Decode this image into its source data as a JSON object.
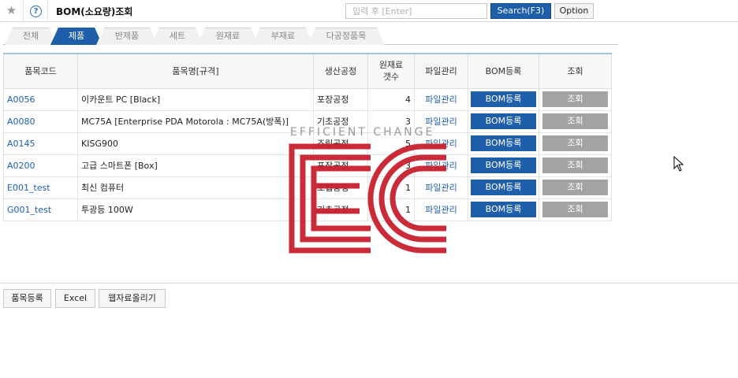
{
  "header": {
    "star_icon": "star-icon",
    "help_glyph": "?",
    "title": "BOM(소요량)조회",
    "search_placeholder": "입력 후 [Enter]",
    "search_value": "",
    "search_button": "Search(F3)",
    "option_button": "Option"
  },
  "tabs": [
    {
      "label": "전체",
      "active": false
    },
    {
      "label": "제품",
      "active": true
    },
    {
      "label": "반제품",
      "active": false
    },
    {
      "label": "세트",
      "active": false
    },
    {
      "label": "원재료",
      "active": false
    },
    {
      "label": "부재료",
      "active": false
    },
    {
      "label": "다공정품목",
      "active": false
    }
  ],
  "table": {
    "headers": [
      "품목코드",
      "품목명[규격]",
      "생산공정",
      "원재료\n갯수",
      "파일관리",
      "BOM등록",
      "조회"
    ],
    "rows": [
      {
        "code": "A0056",
        "name": "이카운트 PC [Black]",
        "process": "포장공정",
        "count": "4",
        "file": "파일관리",
        "bom": "BOM등록",
        "view": "조회"
      },
      {
        "code": "A0080",
        "name": "MC75A [Enterprise PDA Motorola : MC75A(방폭)]",
        "process": "기초공정",
        "count": "3",
        "file": "파일관리",
        "bom": "BOM등록",
        "view": "조회"
      },
      {
        "code": "A0145",
        "name": "KISG900",
        "process": "조립공정",
        "count": "5",
        "file": "파일관리",
        "bom": "BOM등록",
        "view": "조회"
      },
      {
        "code": "A0200",
        "name": "고급 스마트폰 [Box]",
        "process": "포장공정",
        "count": "3",
        "file": "파일관리",
        "bom": "BOM등록",
        "view": "조회"
      },
      {
        "code": "E001_test",
        "name": "최신 컴퓨터",
        "process": "조립공정",
        "count": "1",
        "file": "파일관리",
        "bom": "BOM등록",
        "view": "조회"
      },
      {
        "code": "G001_test",
        "name": "투광등 100W",
        "process": "기초공정",
        "count": "1",
        "file": "파일관리",
        "bom": "BOM등록",
        "view": "조회"
      }
    ]
  },
  "watermark": {
    "text": "EFFICIENT CHANGE",
    "logo": "EC",
    "color": "#c8202f"
  },
  "footer": {
    "buttons": [
      "품목등록",
      "Excel",
      "웹자료올리기"
    ]
  },
  "colors": {
    "accent": "#1f5fa9",
    "view_button": "#a3a3a3"
  }
}
